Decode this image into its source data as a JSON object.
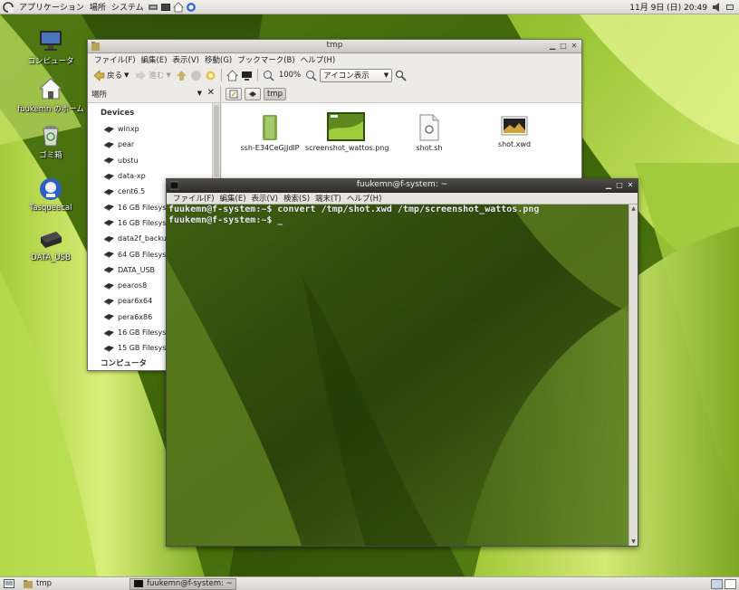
{
  "top_panel": {
    "menus": [
      "アプリケーション",
      "場所",
      "システム"
    ],
    "clock": "11月 9日 (日) 20:49"
  },
  "desktop": {
    "icons": [
      {
        "label": "コンピュータ",
        "icon": "computer-icon"
      },
      {
        "label": "fuukemn のホーム",
        "icon": "home-folder-icon"
      },
      {
        "label": "ゴミ箱",
        "icon": "trash-icon"
      },
      {
        "label": "Tasqueecal",
        "icon": "app-globe-icon"
      },
      {
        "label": "DATA_USB",
        "icon": "usb-drive-icon"
      }
    ]
  },
  "file_manager": {
    "title": "tmp",
    "menu": [
      "ファイル(F)",
      "編集(E)",
      "表示(V)",
      "移動(G)",
      "ブックマーク(B)",
      "ヘルプ(H)"
    ],
    "toolbar": {
      "back": "戻る",
      "forward": "進む",
      "zoom": "100%",
      "view_mode": "アイコン表示"
    },
    "sidebar": {
      "header": "場所",
      "section": "Devices",
      "items": [
        "winxp",
        "pear",
        "ubstu",
        "data-xp",
        "cent6.5",
        "16 GB Filesystem",
        "16 GB Filesystem",
        "data2f_backup",
        "64 GB Filesystem",
        "DATA_USB",
        "pearos8",
        "pear6x64",
        "pera6x86",
        "16 GB Filesystem",
        "15 GB Filesystem"
      ],
      "footer_section": "コンピュータ"
    },
    "path": [
      "tmp"
    ],
    "files": [
      {
        "name": "ssh-E34CeGjJdlP",
        "icon": "folder-icon"
      },
      {
        "name": "screenshot_wattos.png",
        "icon": "image-thumbnail-icon"
      },
      {
        "name": "shot.sh",
        "icon": "script-file-icon"
      },
      {
        "name": "shot.xwd",
        "icon": "image-file-icon"
      }
    ]
  },
  "terminal": {
    "title": "fuukemn@f-system: ~",
    "menu": [
      "ファイル(F)",
      "編集(E)",
      "表示(V)",
      "検索(S)",
      "端末(T)",
      "ヘルプ(H)"
    ],
    "lines": [
      "fuukemn@f-system:~$ convert /tmp/shot.xwd /tmp/screenshot_wattos.png",
      "fuukemn@f-system:~$ _"
    ]
  },
  "bottom_panel": {
    "tasks": [
      {
        "label": "tmp",
        "active": false
      },
      {
        "label": "fuukemn@f-system: ~",
        "active": true
      }
    ]
  },
  "colors": {
    "wallpaper_dark": "#2f4a08",
    "wallpaper_light": "#c6e06a",
    "panel": "#dcdad5",
    "terminal_text": "#f3f3f3"
  }
}
